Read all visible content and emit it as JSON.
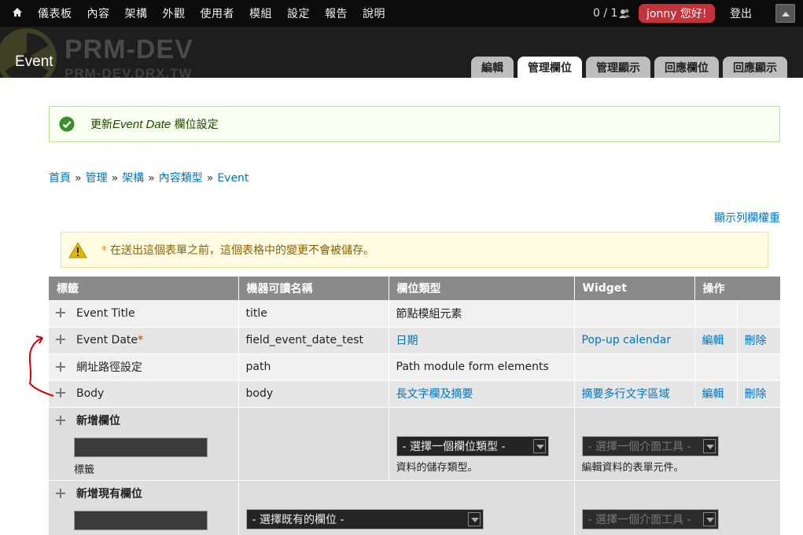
{
  "toolbar": {
    "menu": [
      "儀表板",
      "內容",
      "架構",
      "外觀",
      "使用者",
      "模組",
      "設定",
      "報告",
      "說明"
    ],
    "counter": "0 / 1",
    "greeting": "jonny 您好!",
    "logout": "登出"
  },
  "branding": {
    "site_name": "PRM-DEV",
    "site_url": "PRM-DEV.DRX.TW",
    "page_title": "Event"
  },
  "tabs": [
    {
      "label": "編輯",
      "active": false
    },
    {
      "label": "管理欄位",
      "active": true
    },
    {
      "label": "管理顯示",
      "active": false
    },
    {
      "label": "回應欄位",
      "active": false
    },
    {
      "label": "回應顯示",
      "active": false
    }
  ],
  "status": {
    "prefix": "更新",
    "field": "Event Date",
    "suffix": " 欄位設定"
  },
  "breadcrumb": [
    "首頁",
    "管理",
    "架構",
    "內容類型",
    "Event"
  ],
  "weights_link": "顯示列欄權重",
  "warning": {
    "star": "*",
    "text": "在送出這個表單之前，這個表格中的變更不會被儲存。"
  },
  "table": {
    "headers": [
      "標籤",
      "機器可讀名稱",
      "欄位類型",
      "Widget",
      "操作"
    ],
    "rows": [
      {
        "label": "Event Title",
        "machine": "title",
        "type": "節點模組元素",
        "widget": "",
        "edit": "",
        "delete": ""
      },
      {
        "label": "Event Date",
        "required": "*",
        "machine": "field_event_date_test",
        "type": "日期",
        "widget": "Pop-up calendar",
        "edit": "編輯",
        "delete": "刪除"
      },
      {
        "label": "網址路徑設定",
        "machine": "path",
        "type": "Path module form elements",
        "widget": "",
        "edit": "",
        "delete": ""
      },
      {
        "label": "Body",
        "machine": "body",
        "type": "長文字欄及摘要",
        "widget": "摘要多行文字區域",
        "edit": "編輯",
        "delete": "刪除"
      }
    ],
    "new_field": {
      "title": "新增欄位",
      "label_caption": "標籤",
      "type_select": "- 選擇一個欄位類型 -",
      "type_desc": "資料的儲存類型。",
      "widget_select": "- 選擇一個介面工具 -",
      "widget_desc": "編輯資料的表單元件。"
    },
    "existing_field": {
      "title": "新增現有欄位",
      "field_select": "- 選擇既有的欄位 -",
      "widget_select": "- 選擇一個介面工具 -"
    }
  },
  "colors": {
    "toolbar": "#0b0b0b",
    "greeting_bg": "#c4323a",
    "link": "#0074bd",
    "status_bg": "#f8fff0",
    "warning_bg": "#fffce4",
    "table_header": "#8a8a8a"
  }
}
